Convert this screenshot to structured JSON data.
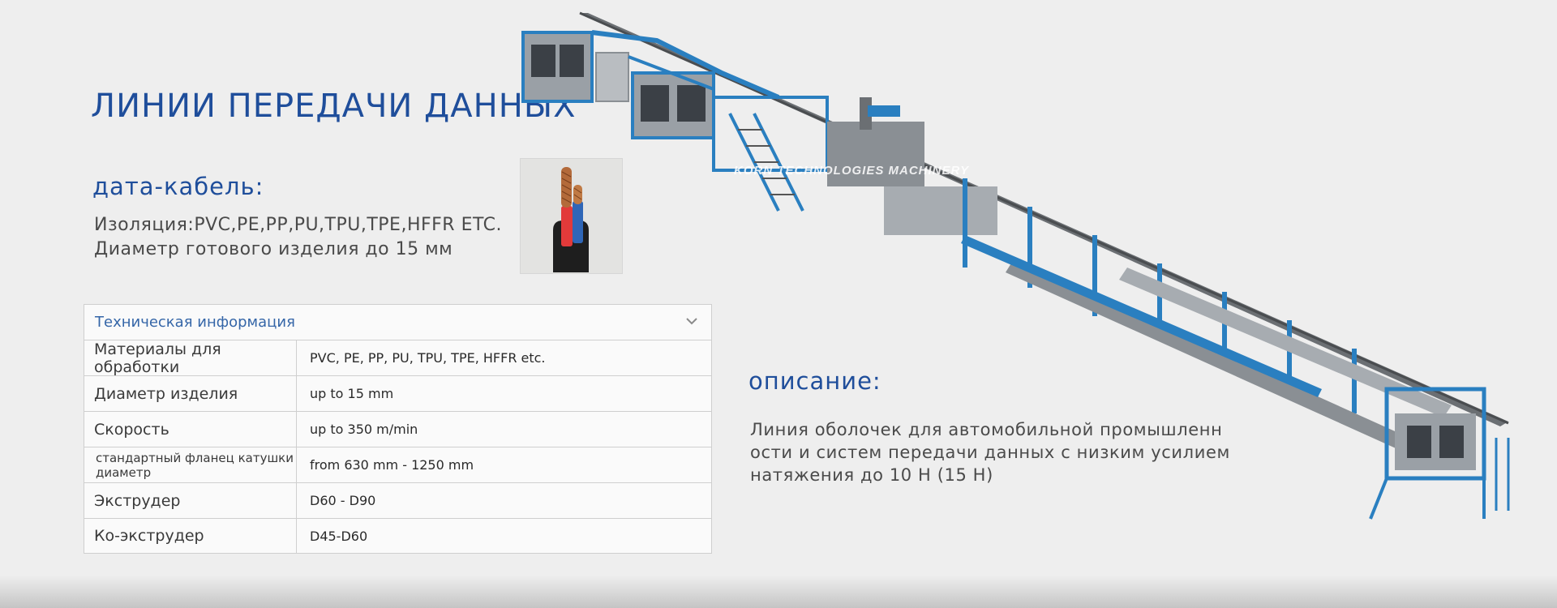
{
  "page": {
    "title": "ЛИНИИ ПЕРЕДАЧИ ДАННЫХ",
    "subtitle": "дата-кабель:",
    "spec_lines": [
      "Изоляция:PVC,PE,PP,PU,TPU,TPE,HFFR ETC.",
      "Диаметр готового изделия до 15 мм"
    ]
  },
  "tech_table": {
    "header": "Техническая информация",
    "rows": [
      {
        "key": "Материалы для обработки",
        "value": "PVC, PE, PP, PU, TPU, TPE, HFFR etc."
      },
      {
        "key": "Диаметр изделия",
        "value": "up to 15 mm"
      },
      {
        "key": "Скорость",
        "value": "up to 350 m/min"
      },
      {
        "key": "стандартный фланец катушки диаметр",
        "value": "from 630 mm - 1250 mm"
      },
      {
        "key": "Экструдер",
        "value": "D60 - D90"
      },
      {
        "key": "Ко-экструдер",
        "value": "D45-D60"
      }
    ]
  },
  "description": {
    "title": "описание:",
    "lines": [
      "Линия оболочек для автомобильной промышленн",
      "ости и систем передачи данных с низким усилием",
      "натяжения до 10 Н (15 Н)"
    ]
  },
  "watermark": "KORN TECHNOLOGIES MACHINERY",
  "colors": {
    "accent": "#1f4e9b",
    "machine_blue": "#2a7fc0",
    "machine_grey": "#8a8f94",
    "background": "#eeeeee"
  },
  "icons": {
    "chevron": "chevron-down-icon"
  }
}
